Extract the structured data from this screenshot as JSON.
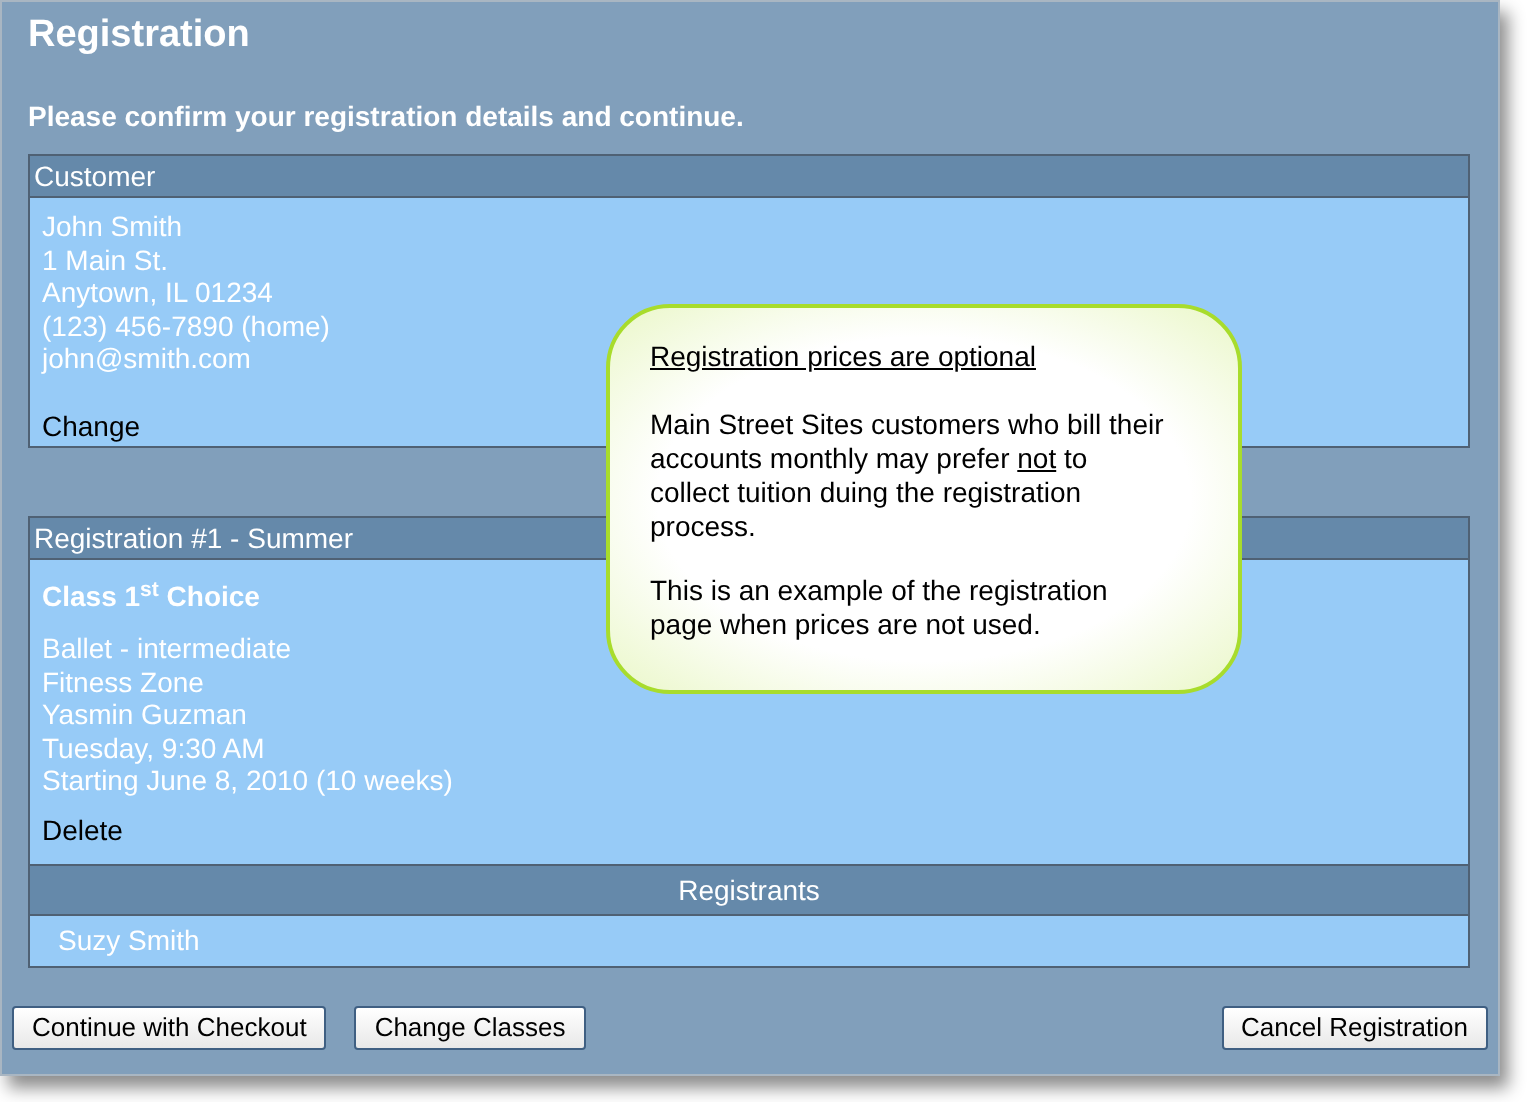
{
  "title": "Registration",
  "instruction": "Please confirm your registration details and continue.",
  "customer": {
    "header": "Customer",
    "lines": [
      "John Smith",
      "1 Main St.",
      "Anytown, IL 01234",
      "(123) 456-7890 (home)",
      "john@smith.com"
    ],
    "action": "Change"
  },
  "registration": {
    "header": "Registration #1 - Summer",
    "class_title": "Class 1$^{st}$ Choice",
    "lines": [
      "Ballet - intermediate",
      "Fitness Zone",
      "Yasmin Guzman",
      "Tuesday, 9:30 AM",
      "Starting June 8, 2010 (10 weeks)"
    ],
    "action": "Delete",
    "registrants_header": "Registrants",
    "registrants": [
      "Suzy Smith"
    ]
  },
  "left_buttons": [
    "Continue with Checkout",
    "Change Classes"
  ],
  "right_buttons": [
    "Cancel Registration"
  ],
  "callout": {
    "heading": "Registration prices are optional",
    "paragraphs": [
      {
        "before": "Main Street Sites customers who bill their accounts monthly may prefer ",
        "underlined": "not",
        "after": " to collect tuition duing the registration process."
      },
      {
        "before": "This is an example of the registration page when prices are not used."
      }
    ]
  }
}
